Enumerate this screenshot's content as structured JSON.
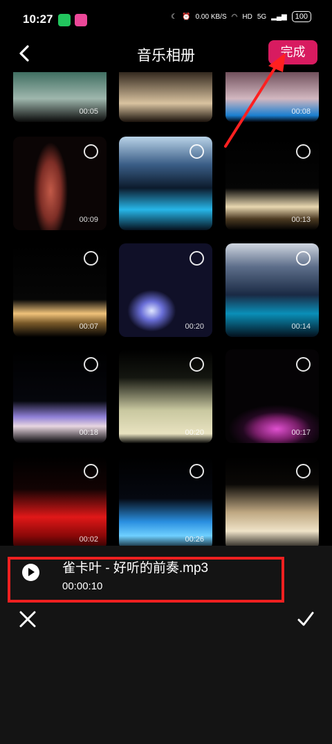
{
  "status": {
    "time": "10:27",
    "net_speed": "0.00",
    "net_unit": "KB/S",
    "hd": "HD",
    "signal": "5G",
    "battery": "100"
  },
  "header": {
    "title": "音乐相册",
    "done_label": "完成"
  },
  "tiles": [
    {
      "duration": "00:05"
    },
    {
      "duration": ""
    },
    {
      "duration": "00:08"
    },
    {
      "duration": "00:09"
    },
    {
      "duration": ""
    },
    {
      "duration": "00:13"
    },
    {
      "duration": "00:07"
    },
    {
      "duration": "00:20"
    },
    {
      "duration": "00:14"
    },
    {
      "duration": "00:18"
    },
    {
      "duration": "00:20"
    },
    {
      "duration": "00:17"
    },
    {
      "duration": "00:02"
    },
    {
      "duration": "00:26"
    },
    {
      "duration": ""
    }
  ],
  "music": {
    "song": "雀卡叶 - 好听的前奏.mp3",
    "duration": "00:00:10"
  }
}
